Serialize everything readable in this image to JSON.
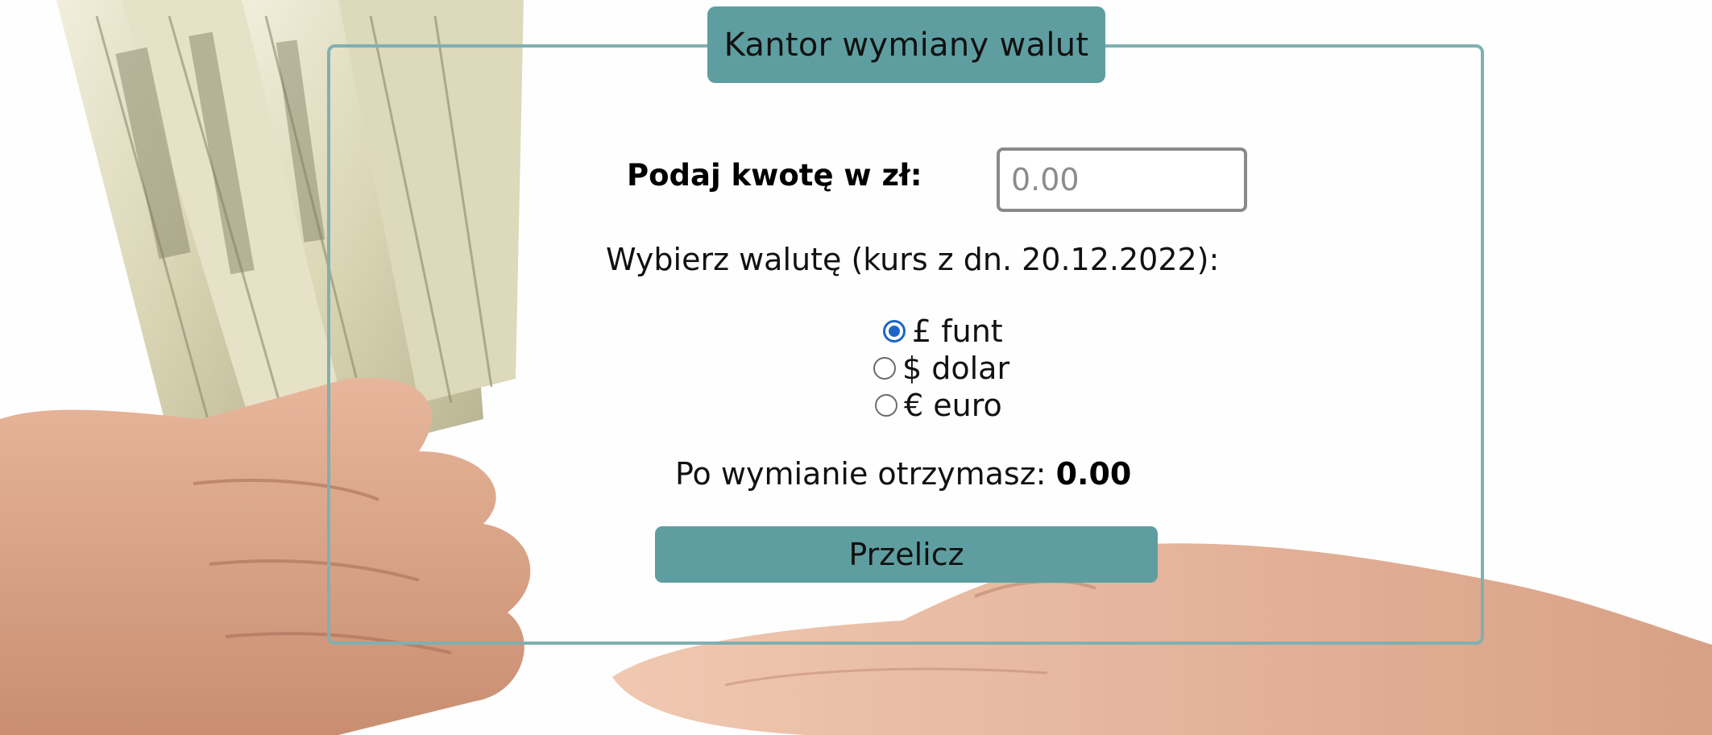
{
  "form": {
    "legend": "Kantor wymiany walut",
    "amount_label": "Podaj kwotę w zł:",
    "amount_placeholder": "0.00",
    "currency_prompt": "Wybierz walutę (kurs z dn. 20.12.2022):",
    "currencies": [
      {
        "label": "£ funt",
        "selected": true
      },
      {
        "label": "$ dolar",
        "selected": false
      },
      {
        "label": "€ euro",
        "selected": false
      }
    ],
    "result_label": "Po wymianie otrzymasz:",
    "result_value": "0.00",
    "button_label": "Przelicz"
  },
  "colors": {
    "accent": "#5f9ea0",
    "frame_border": "#7fb0b2",
    "radio_selected": "#1a67c9"
  },
  "background": {
    "icon": "money-in-hands-photo"
  }
}
